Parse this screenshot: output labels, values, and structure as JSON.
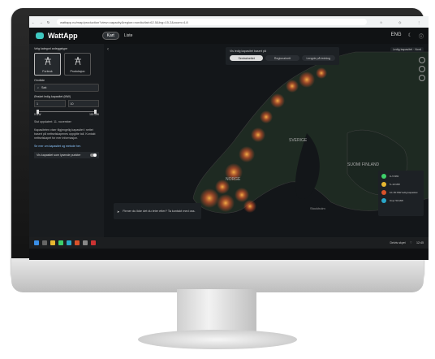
{
  "browser": {
    "url": "wattapp.no/map/production?view=capacity&region=nordic#lat=62.5&lng=15.2&zoom=4.8"
  },
  "app": {
    "name": "WattApp",
    "view_toggle": [
      "Kart",
      "Liste"
    ],
    "header_right": [
      "ENG"
    ]
  },
  "sidebar": {
    "section_title": "Velg kategori anleggstype",
    "types": [
      {
        "label": "Forbruk"
      },
      {
        "label": "Produksjon"
      }
    ],
    "search_label": "Område",
    "search_value": "Søk",
    "capacity_label": "Ønsket ledig kapasitet (MW)",
    "range_from": "1",
    "range_to": "10",
    "min_label": "0 MW",
    "max_label": "100 MW",
    "note1": "Sist oppdatert: 11. november",
    "note2": "Kapasiteten viser tilgjengelig kapasitet i nettet basert på nettselskapenes oppgitte tall. Kontakt nettselskapet for mer informasjon.",
    "note3": "Se mer om kapasitet og metode her.",
    "switch_label": "Vis kapasitet som lysende punkter"
  },
  "map": {
    "toggle_heading": "Vis ledig kapasitet basert på",
    "toggle_options": [
      "Sentralnettet",
      "Regionalnett",
      "Lengde på ledning"
    ],
    "timestamp": "Ledig kapasitet · Nord",
    "labels": {
      "sweden": "SVERIGE",
      "norway": "NORGE",
      "finland": "SUOMI\nFINLAND",
      "stockholm": "Stockholm"
    },
    "legend": [
      {
        "label": "0–5 MW",
        "color": "#3ecf6a"
      },
      {
        "label": "5–10 MW",
        "color": "#e7b731"
      },
      {
        "label": "10–50 MW ledig kapasitet",
        "color": "#d9522a"
      },
      {
        "label": "Over 50 MW",
        "color": "#2aa7c9"
      }
    ],
    "help_text": "Finner du ikke det du leter etter? Ta kontakt med oss."
  },
  "taskbar": {
    "clock": "12:45",
    "weather": "Delvis skyet"
  }
}
